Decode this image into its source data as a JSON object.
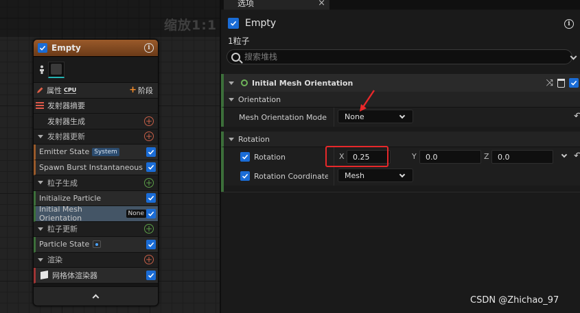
{
  "graph": {
    "zoom_label": "缩放1:1"
  },
  "node": {
    "title": "Empty",
    "props_label": "属性",
    "cpu_tag": "CPU",
    "stage_label": "阶段",
    "summary_label": "发射器摘要",
    "emitter_spawn_label": "发射器生成",
    "emitter_update_label": "发射器更新",
    "emitter_state_label": "Emitter State",
    "emitter_state_badge": "System",
    "spawn_burst_label": "Spawn Burst Instantaneous",
    "particle_spawn_label": "粒子生成",
    "initialize_particle_label": "Initialize Particle",
    "initial_mesh_label": "Initial Mesh Orientation",
    "initial_mesh_badge": "None",
    "particle_update_label": "粒子更新",
    "particle_state_label": "Particle State",
    "render_label": "渲染",
    "mesh_renderer_label": "网格体渲染器"
  },
  "panel": {
    "tab_label": "选项",
    "title": "Empty",
    "count": "1粒子",
    "search_placeholder": "搜索堆栈",
    "module_title": "Initial Mesh Orientation",
    "section_orientation": "Orientation",
    "mesh_orientation_mode_label": "Mesh Orientation Mode",
    "mesh_orientation_mode_value": "None",
    "section_rotation": "Rotation",
    "rotation_label": "Rotation",
    "rotation_x_label": "X",
    "rotation_x": "0.25",
    "rotation_y_label": "Y",
    "rotation_y": "0.0",
    "rotation_z_label": "Z",
    "rotation_z": "0.0",
    "rotation_coord_label": "Rotation Coordinate Space",
    "rotation_coord_value": "Mesh"
  },
  "watermark": "CSDN @Zhichao_97",
  "colors": {
    "accent_check": "#1a6cd6",
    "header_orange": "#9a5a2a",
    "module_green": "#3c6f3a",
    "highlight_red": "#e8282a"
  }
}
